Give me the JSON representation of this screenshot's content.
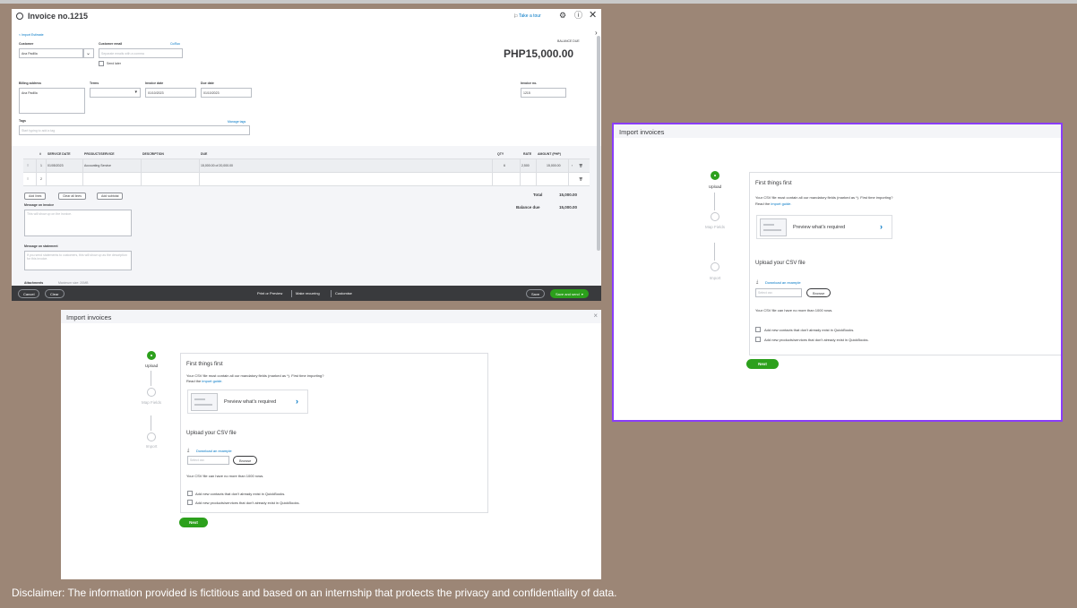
{
  "invoice": {
    "title": "Invoice no.1215",
    "take_tour": "Take a tour",
    "back_link": "< Import Estimate",
    "customer_label": "Customer",
    "customer_value": "Ana Padilla",
    "customer_email_label": "Customer email",
    "customer_email_placeholder": "Separate emails with a comma",
    "cc_bcc": "Cc/Bcc",
    "send_later": "Send later",
    "balance_due_label": "BALANCE DUE",
    "balance_due_value": "PHP15,000.00",
    "billing_address_label": "Billing address",
    "billing_address_value": "Ana Padilla",
    "terms_label": "Terms",
    "invoice_date_label": "Invoice date",
    "invoice_date_value": "01/10/2023",
    "due_date_label": "Due date",
    "due_date_value": "01/10/2023",
    "invoice_no_label": "Invoice no.",
    "invoice_no_value": "1215",
    "tags_label": "Tags",
    "tags_placeholder": "Start typing to add a tag",
    "manage_tags": "Manage tags",
    "columns": {
      "num": "#",
      "service_date": "SERVICE DATE",
      "product": "PRODUCT/SERVICE",
      "description": "DESCRIPTION",
      "due": "DUE",
      "qty": "QTY",
      "rate": "RATE",
      "amount": "AMOUNT (PHP)"
    },
    "rows": [
      {
        "num": "1",
        "service_date": "01/05/2023",
        "product": "Accounting Service",
        "description": "",
        "due": "15,000.00 of 20,000.00",
        "qty": "6",
        "rate": "2,500",
        "amount": "15,000.00"
      },
      {
        "num": "2",
        "service_date": "",
        "product": "",
        "description": "",
        "due": "",
        "qty": "",
        "rate": "",
        "amount": ""
      }
    ],
    "add_lines": "Add lines",
    "clear_all_lines": "Clear all lines",
    "add_subtotal": "Add subtotal",
    "total_label": "Total",
    "total_value": "15,000.00",
    "balance_label": "Balance due",
    "balance_value": "15,000.00",
    "message_invoice_label": "Message on invoice",
    "message_invoice_placeholder": "This will show up on the invoice.",
    "message_statement_label": "Message on statement",
    "message_statement_placeholder": "If you send statements to customers, this will show up as the description for this invoice.",
    "attachments": "Attachments",
    "attachments_max": "Maximum size: 20MB",
    "footer": {
      "cancel": "Cancel",
      "clear": "Clear",
      "print_preview": "Print or Preview",
      "make_recurring": "Make recurring",
      "customise": "Customise",
      "save": "Save",
      "save_and_send": "Save and send"
    }
  },
  "import": {
    "title": "Import invoices",
    "steps": [
      {
        "label": "Upload",
        "active": true
      },
      {
        "label": "Map Fields",
        "active": false
      },
      {
        "label": "Import",
        "active": false
      }
    ],
    "heading": "First things first",
    "csv_note": "Your CSV file must contain all our mandatory fields (marked as *). First time importing?",
    "read_the": "Read the",
    "import_guide": "import guide.",
    "preview": "Preview what's required",
    "upload_heading": "Upload your CSV file",
    "download_example": "Download an example",
    "select_csv": "Select csv",
    "browse": "Browse",
    "row_limit": "Your CSV file can have no more than 1000 rows.",
    "check_contacts": "Add new contacts that don't already exist in QuickBooks.",
    "check_products": "Add new products/services that don't already exist in QuickBooks.",
    "next": "Next"
  },
  "disclaimer": "Disclaimer: The information provided is fictitious and based on an internship that protects the privacy and confidentiality of data.",
  "colors": {
    "brand_green": "#2ca01c",
    "link_blue": "#0077c5",
    "highlight_purple": "#8a3dfa",
    "background": "#9c8676"
  }
}
